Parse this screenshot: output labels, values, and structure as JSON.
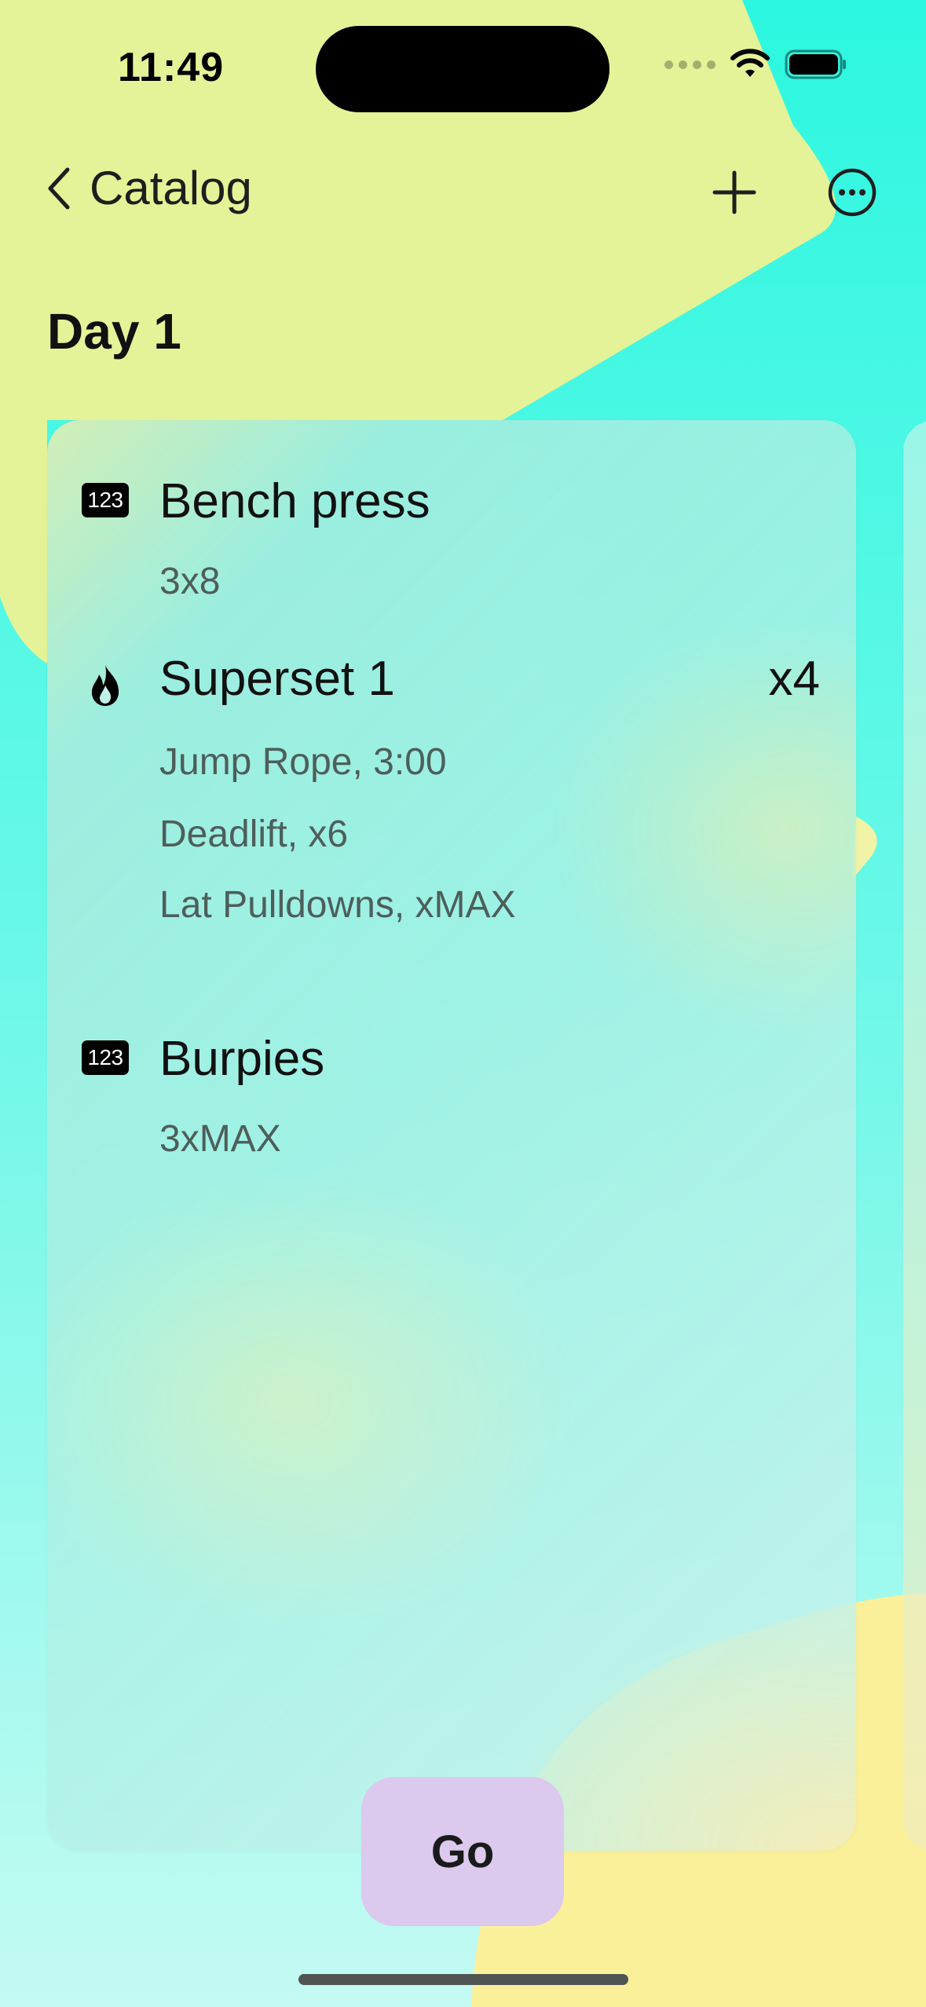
{
  "status_bar": {
    "time": "11:49"
  },
  "nav": {
    "back_label": "Catalog",
    "back_icon": "chevron-left-icon",
    "add_icon": "plus-icon",
    "more_icon": "ellipsis-circle-icon"
  },
  "page": {
    "title": "Day 1"
  },
  "workout": {
    "items": [
      {
        "icon": "number-123-icon",
        "icon_text": "123",
        "title": "Bench press",
        "details": [
          "3x8"
        ]
      },
      {
        "icon": "flame-icon",
        "title": "Superset 1",
        "count": "x4",
        "details": [
          "Jump Rope,  3:00",
          "Deadlift,  x6",
          "Lat Pulldowns,  xMAX"
        ]
      },
      {
        "icon": "number-123-icon",
        "icon_text": "123",
        "title": "Burpies",
        "details": [
          "3xMAX"
        ]
      }
    ]
  },
  "actions": {
    "go_label": "Go"
  },
  "colors": {
    "background_cyan": "#2cf7e0",
    "background_yellow_green": "#e4f397",
    "background_yellow": "#fbf09a",
    "go_button": "#dbc9ee"
  }
}
